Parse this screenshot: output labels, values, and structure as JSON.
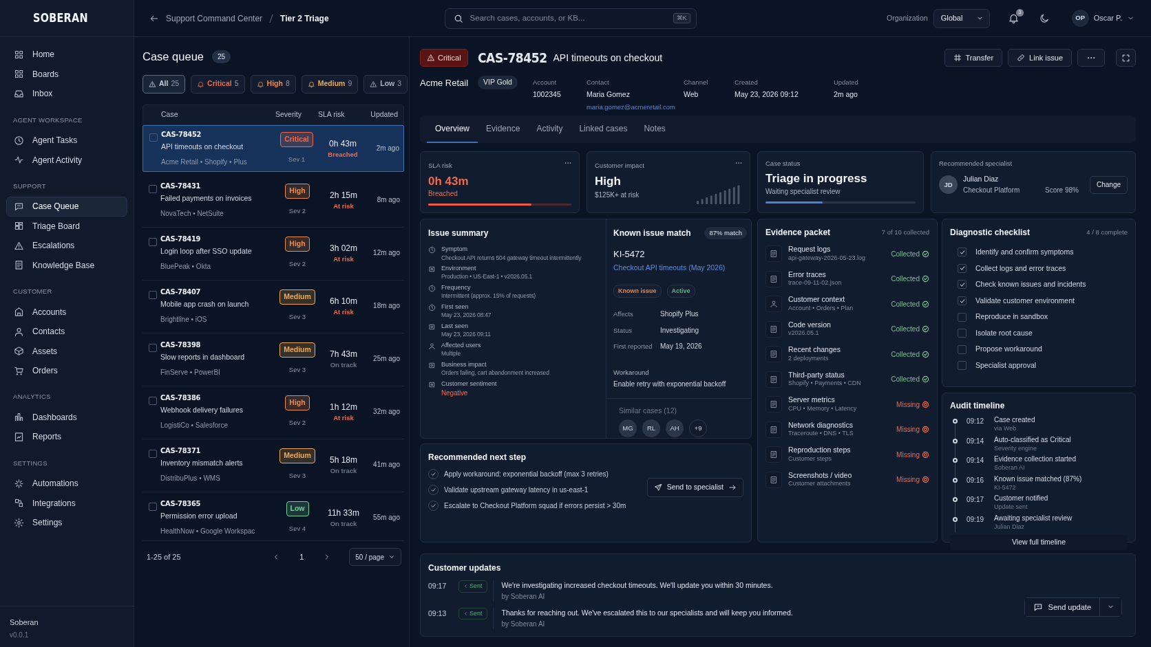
{
  "brand": {
    "name": "SOBERAN"
  },
  "sidebar": {
    "sections": [
      {
        "items": [
          {
            "label": "Home",
            "selected": false
          },
          {
            "label": "Boards",
            "selected": false
          },
          {
            "label": "Inbox",
            "selected": false
          }
        ]
      },
      {
        "title": "AGENT WORKSPACE",
        "items": [
          {
            "label": "Agent Tasks",
            "selected": false
          },
          {
            "label": "Agent Activity",
            "selected": false
          }
        ]
      },
      {
        "title": "SUPPORT",
        "items": [
          {
            "label": "Case Queue",
            "selected": true
          },
          {
            "label": "Triage Board",
            "selected": false
          },
          {
            "label": "Escalations",
            "selected": false
          },
          {
            "label": "Knowledge Base",
            "selected": false
          }
        ]
      },
      {
        "title": "CUSTOMER",
        "items": [
          {
            "label": "Accounts",
            "selected": false
          },
          {
            "label": "Contacts",
            "selected": false
          },
          {
            "label": "Assets",
            "selected": false
          },
          {
            "label": "Orders",
            "selected": false
          }
        ]
      },
      {
        "title": "ANALYTICS",
        "items": [
          {
            "label": "Dashboards",
            "selected": false
          },
          {
            "label": "Reports",
            "selected": false
          }
        ]
      },
      {
        "title": "SETTINGS",
        "items": [
          {
            "label": "Automations",
            "selected": false
          },
          {
            "label": "Integrations",
            "selected": false
          },
          {
            "label": "Settings",
            "selected": false
          }
        ]
      }
    ],
    "footer": {
      "name": "Soberan",
      "version": "v0.0.1"
    }
  },
  "breadcrumb": [
    {
      "label": "Support Command Center"
    },
    {
      "label": "Tier 2 Triage"
    }
  ],
  "search": {
    "placeholder": "Search cases, accounts, or KB...",
    "shortcut": "⌘K"
  },
  "organization": {
    "label": "Organization",
    "value": "Global"
  },
  "notifications": {
    "count": "3"
  },
  "user": {
    "initials": "OP",
    "name": "Oscar P."
  },
  "queue": {
    "title": "Case queue",
    "count": "25",
    "filters": [
      {
        "label": "All",
        "count": "25",
        "selected": true,
        "color": "#c9d1dc"
      },
      {
        "label": "Critical",
        "count": "5",
        "selected": false,
        "color": "#ef6a4c"
      },
      {
        "label": "High",
        "count": "8",
        "selected": false,
        "color": "#f08c4b"
      },
      {
        "label": "Medium",
        "count": "9",
        "selected": false,
        "color": "#f2a94d"
      },
      {
        "label": "Low",
        "count": "3",
        "selected": false,
        "color": "#aab4c3"
      }
    ],
    "columns": [
      "Case",
      "Severity",
      "SLA risk",
      "Updated"
    ],
    "rows": [
      {
        "id": "CAS-78452",
        "title": "API timeouts on checkout",
        "meta": "Acme Retail • Shopify • Plus",
        "severity": {
          "label": "Critical",
          "color": "#ef6a4c"
        },
        "sev": "Sev 1",
        "sla": "0h 43m",
        "sla_status": "Breached",
        "at_risk": true,
        "updated": "2m ago",
        "selected": true,
        "checked": false
      },
      {
        "id": "CAS-78431",
        "title": "Failed payments on invoices",
        "meta": "NovaTech • NetSuite",
        "severity": {
          "label": "High",
          "color": "#f08c4b"
        },
        "sev": "Sev 2",
        "sla": "2h 15m",
        "sla_status": "At risk",
        "at_risk": true,
        "updated": "8m ago",
        "selected": false,
        "checked": false
      },
      {
        "id": "CAS-78419",
        "title": "Login loop after SSO update",
        "meta": "BluePeak • Okta",
        "severity": {
          "label": "High",
          "color": "#f08c4b"
        },
        "sev": "Sev 2",
        "sla": "3h 02m",
        "sla_status": "At risk",
        "at_risk": true,
        "updated": "12m ago",
        "selected": false,
        "checked": false
      },
      {
        "id": "CAS-78407",
        "title": "Mobile app crash on launch",
        "meta": "Brightline • iOS",
        "severity": {
          "label": "Medium",
          "color": "#f2a94d"
        },
        "sev": "Sev 3",
        "sla": "6h 10m",
        "sla_status": "At risk",
        "at_risk": true,
        "updated": "18m ago",
        "selected": false,
        "checked": false
      },
      {
        "id": "CAS-78398",
        "title": "Slow reports in dashboard",
        "meta": "FinServe • PowerBI",
        "severity": {
          "label": "Medium",
          "color": "#f2a94d"
        },
        "sev": "Sev 3",
        "sla": "7h 43m",
        "sla_status": "On track",
        "at_risk": false,
        "updated": "25m ago",
        "selected": false,
        "checked": false
      },
      {
        "id": "CAS-78386",
        "title": "Webhook delivery failures",
        "meta": "LogistiCo • Salesforce",
        "severity": {
          "label": "High",
          "color": "#f08c4b"
        },
        "sev": "Sev 2",
        "sla": "1h 12m",
        "sla_status": "At risk",
        "at_risk": true,
        "updated": "32m ago",
        "selected": false,
        "checked": false
      },
      {
        "id": "CAS-78371",
        "title": "Inventory mismatch alerts",
        "meta": "DistribuPlus • WMS",
        "severity": {
          "label": "Medium",
          "color": "#f2a94d"
        },
        "sev": "Sev 3",
        "sla": "5h 18m",
        "sla_status": "On track",
        "at_risk": false,
        "updated": "41m ago",
        "selected": false,
        "checked": false
      },
      {
        "id": "CAS-78365",
        "title": "Permission error upload",
        "meta": "HealthNow • Google Workspac",
        "severity": {
          "label": "Low",
          "color": "#6fcf97"
        },
        "sev": "Sev 4",
        "sla": "11h 33m",
        "sla_status": "On track",
        "at_risk": false,
        "updated": "55m ago",
        "selected": false,
        "checked": false
      }
    ],
    "pagination": {
      "range": "1-25 of 25",
      "page": "1",
      "per_page": "50 / page"
    }
  },
  "case": {
    "severity": "Critical",
    "id": "CAS-78452",
    "title": "API timeouts on checkout",
    "actions": [
      "Transfer",
      "Link issue"
    ],
    "customer": "Acme Retail",
    "tier": "VIP Gold",
    "fields": [
      {
        "label": "Account",
        "value": "1002345"
      },
      {
        "label": "Contact",
        "value": "Maria Gomez",
        "email": "maria.gomez@acmeretail.com"
      },
      {
        "label": "Channel",
        "value": "Web"
      },
      {
        "label": "Created",
        "value": "May 23, 2026 09:12"
      },
      {
        "label": "Updated",
        "value": "2m ago"
      }
    ],
    "tabs": [
      {
        "label": "Overview",
        "selected": true
      },
      {
        "label": "Evidence",
        "selected": false
      },
      {
        "label": "Activity",
        "selected": false
      },
      {
        "label": "Linked cases",
        "selected": false
      },
      {
        "label": "Notes",
        "selected": false
      }
    ]
  },
  "sla_card": {
    "title": "SLA risk",
    "value": "0h 43m",
    "status": "Breached",
    "level": 0.72
  },
  "impact_card": {
    "title": "Customer impact",
    "value": "High",
    "detail": "$125K+ at risk"
  },
  "status_card": {
    "title": "Case status",
    "value": "Triage in progress",
    "detail": "Waiting specialist review",
    "level": 0.38
  },
  "specialist_card": {
    "title": "Recommended specialist",
    "initials": "JD",
    "name": "Julian Diaz",
    "team": "Checkout Platform",
    "score": "Score 98%",
    "action": "Change"
  },
  "issue_summary": {
    "title": "Issue summary",
    "items": [
      {
        "label": "Symptom",
        "value": "Checkout API returns 504 gateway timeout intermittently",
        "negative": false
      },
      {
        "label": "Environment",
        "value": "Production • US-East-1 • v2026.05.1",
        "negative": false
      },
      {
        "label": "Frequency",
        "value": "Intermittent (approx. 15% of requests)",
        "negative": false
      },
      {
        "label": "First seen",
        "value": "May 23, 2026 08:47",
        "negative": false
      },
      {
        "label": "Last seen",
        "value": "May 23, 2026 09:11",
        "negative": false
      },
      {
        "label": "Affected users",
        "value": "Multiple",
        "negative": false
      },
      {
        "label": "Business impact",
        "value": "Orders failing, cart abandonment increased",
        "negative": false
      },
      {
        "label": "Customer sentiment",
        "value": "Negative",
        "negative": true
      }
    ]
  },
  "known_issue": {
    "title": "Known issue match",
    "match": "87% match",
    "id": "KI-5472",
    "link": "Checkout API timeouts (May 2026)",
    "tags": [
      {
        "label": "Known issue",
        "color": "#e8843f"
      },
      {
        "label": "Active",
        "color": "#5fb37e"
      }
    ],
    "fields": [
      {
        "label": "Affects",
        "value": "Shopify Plus"
      },
      {
        "label": "Status",
        "value": "Investigating"
      },
      {
        "label": "First reported",
        "value": "May 19, 2026"
      }
    ],
    "workaround_label": "Workaround",
    "workaround": "Enable retry with exponential backoff",
    "similar_title": "Similar cases (12)",
    "similar": [
      "MG",
      "RL",
      "AH",
      "+9"
    ]
  },
  "next_step": {
    "title": "Recommended next step",
    "items": [
      {
        "text": "Apply workaround: exponential backoff (max 3 retries)",
        "checked": true
      },
      {
        "text": "Validate upstream gateway latency in us-east-1",
        "checked": true
      },
      {
        "text": "Escalate to Checkout Platform squad if errors persist > 30m",
        "checked": true
      }
    ],
    "action": "Send to specialist"
  },
  "evidence": {
    "title": "Evidence packet",
    "count": "7 of 10 collected",
    "items": [
      {
        "name": "Request logs",
        "detail": "api-gateway-2026-05-23.log",
        "status": "Collected",
        "collected": true
      },
      {
        "name": "Error traces",
        "detail": "trace-09-11-02.json",
        "status": "Collected",
        "collected": true
      },
      {
        "name": "Customer context",
        "detail": "Account • Orders • Plan",
        "status": "Collected",
        "collected": true
      },
      {
        "name": "Code version",
        "detail": "v2026.05.1",
        "status": "Collected",
        "collected": true
      },
      {
        "name": "Recent changes",
        "detail": "2 deployments",
        "status": "Collected",
        "collected": true
      },
      {
        "name": "Third-party status",
        "detail": "Shopify • Payments • CDN",
        "status": "Collected",
        "collected": true
      },
      {
        "name": "Server metrics",
        "detail": "CPU • Memory • Latency",
        "status": "Missing",
        "collected": false
      },
      {
        "name": "Network diagnostics",
        "detail": "Traceroute • DNS • TLS",
        "status": "Missing",
        "collected": false
      },
      {
        "name": "Reproduction steps",
        "detail": "Customer steps",
        "status": "Missing",
        "collected": false
      },
      {
        "name": "Screenshots / video",
        "detail": "Customer attachments",
        "status": "Missing",
        "collected": false
      }
    ]
  },
  "checklist": {
    "title": "Diagnostic checklist",
    "count": "4 / 8 complete",
    "items": [
      {
        "label": "Identify and confirm symptoms",
        "checked": true
      },
      {
        "label": "Collect logs and error traces",
        "checked": true
      },
      {
        "label": "Check known issues and incidents",
        "checked": true
      },
      {
        "label": "Validate customer environment",
        "checked": true
      },
      {
        "label": "Reproduce in sandbox",
        "checked": false
      },
      {
        "label": "Isolate root cause",
        "checked": false
      },
      {
        "label": "Propose workaround",
        "checked": false
      },
      {
        "label": "Specialist approval",
        "checked": false
      }
    ]
  },
  "audit": {
    "title": "Audit timeline",
    "items": [
      {
        "time": "09:12",
        "event": "Case created",
        "source": "via Web"
      },
      {
        "time": "09:14",
        "event": "Auto-classified as Critical",
        "source": "Severity engine"
      },
      {
        "time": "09:14",
        "event": "Evidence collection started",
        "source": "Soberan AI"
      },
      {
        "time": "09:16",
        "event": "Known issue matched (87%)",
        "source": "KI-5472"
      },
      {
        "time": "09:17",
        "event": "Customer notified",
        "source": "Update sent"
      },
      {
        "time": "09:19",
        "event": "Awaiting specialist review",
        "source": "Julian Diaz"
      }
    ],
    "action": "View full timeline"
  },
  "updates": {
    "title": "Customer updates",
    "items": [
      {
        "time": "09:17",
        "status": "Sent",
        "text": "We're investigating increased checkout timeouts. We'll update you within 30 minutes.",
        "author": "by Soberan AI"
      },
      {
        "time": "09:13",
        "status": "Sent",
        "text": "Thanks for reaching out. We've escalated this to our specialists and will keep you informed.",
        "author": "by Soberan AI"
      }
    ],
    "action": "Send update"
  }
}
